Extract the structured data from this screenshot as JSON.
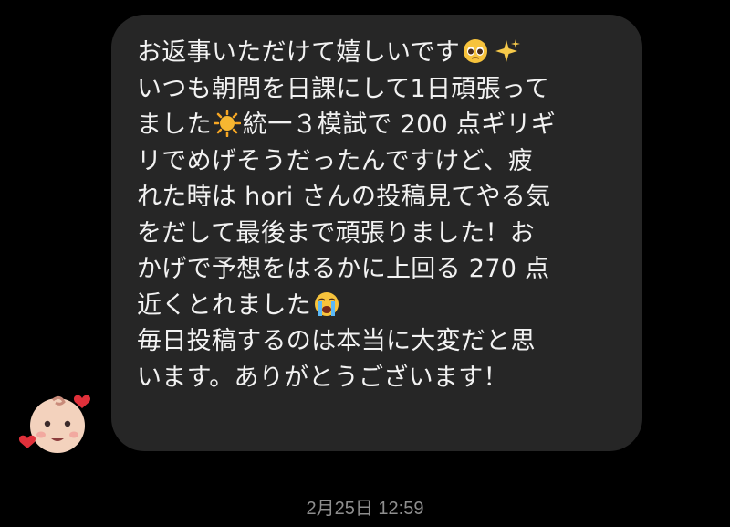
{
  "message": {
    "segments": [
      {
        "type": "text",
        "value": "お返事いただけて嬉しいです"
      },
      {
        "type": "emoji",
        "icon": "pleading-face-emoji"
      },
      {
        "type": "emoji",
        "icon": "sparkles-emoji"
      },
      {
        "type": "text",
        "value": "\nいつも朝問を日課にして1日頑張って\nました"
      },
      {
        "type": "emoji",
        "icon": "sun-emoji"
      },
      {
        "type": "text",
        "value": "統一３模試で 200 点ギリギ\nリでめげそうだったんですけど、疲\nれた時は hori さんの投稿見てやる気\nをだして最後まで頑張りました！お\nかげで予想をはるかに上回る 270 点\n近くとれました"
      },
      {
        "type": "emoji",
        "icon": "loudly-crying-face-emoji"
      },
      {
        "type": "text",
        "value": "\n毎日投稿するのは本当に大変だと思\nいます。ありがとうございます！"
      }
    ]
  },
  "timestamp": "2月25日 12:59",
  "avatar": {
    "icon": "baby-face-with-hearts-avatar"
  },
  "colors": {
    "background": "#000000",
    "bubble": "#262626",
    "text": "#f2f2f2",
    "timestamp": "#8e8e8e"
  }
}
